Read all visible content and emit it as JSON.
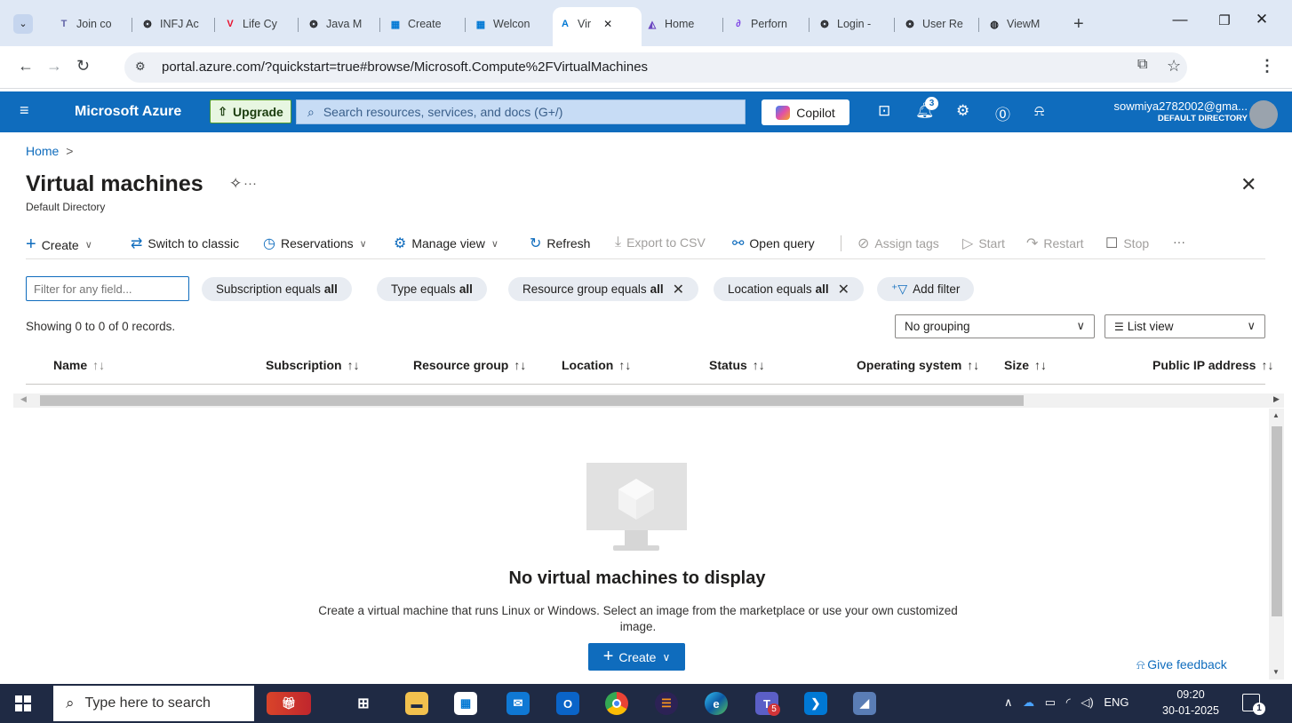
{
  "browser": {
    "tabs": [
      {
        "label": "Join co",
        "icon": "teams-icon",
        "color": "#6264a7"
      },
      {
        "label": "INFJ Ac",
        "icon": "chatgpt-icon",
        "color": "#202124"
      },
      {
        "label": "Life Cy",
        "icon": "v-logo-icon",
        "color": "#e8112d"
      },
      {
        "label": "Java M",
        "icon": "chatgpt-icon",
        "color": "#202124"
      },
      {
        "label": "Create",
        "icon": "ms-icon",
        "color": "#0078d4"
      },
      {
        "label": "Welcon",
        "icon": "ms-icon",
        "color": "#0078d4"
      },
      {
        "label": "Vir",
        "icon": "azure-icon",
        "color": "#0078d4",
        "active": true
      },
      {
        "label": "Home",
        "icon": "ai-icon",
        "color": "#6b46c1"
      },
      {
        "label": "Perforn",
        "icon": "flame-icon",
        "color": "#7b3fe4"
      },
      {
        "label": "Login -",
        "icon": "chatgpt-icon",
        "color": "#202124"
      },
      {
        "label": "User Re",
        "icon": "chatgpt-icon",
        "color": "#202124"
      },
      {
        "label": "ViewM",
        "icon": "globe-icon",
        "color": "#202124"
      }
    ],
    "url": "portal.azure.com/?quickstart=true#browse/Microsoft.Compute%2FVirtualMachines",
    "new_tab": "+"
  },
  "azure_header": {
    "brand": "Microsoft Azure",
    "upgrade": "Upgrade",
    "search_placeholder": "Search resources, services, and docs (G+/)",
    "copilot": "Copilot",
    "notifications_count": "3",
    "user_email": "sowmiya2782002@gma...",
    "user_directory": "DEFAULT DIRECTORY"
  },
  "page": {
    "breadcrumb_home": "Home",
    "breadcrumb_sep": ">",
    "title": "Virtual machines",
    "subtitle": "Default Directory"
  },
  "commands": {
    "create": "Create",
    "switch_classic": "Switch to classic",
    "reservations": "Reservations",
    "manage_view": "Manage view",
    "refresh": "Refresh",
    "export_csv": "Export to CSV",
    "open_query": "Open query",
    "assign_tags": "Assign tags",
    "start": "Start",
    "restart": "Restart",
    "stop": "Stop",
    "more": "···"
  },
  "filters": {
    "placeholder": "Filter for any field...",
    "subscription": {
      "label": "Subscription equals",
      "value": "all"
    },
    "type": {
      "label": "Type equals",
      "value": "all"
    },
    "resource_group": {
      "label": "Resource group equals",
      "value": "all"
    },
    "location": {
      "label": "Location equals",
      "value": "all"
    },
    "add_filter": "Add filter"
  },
  "records": "Showing 0 to 0 of 0 records.",
  "grouping": "No grouping",
  "view": "List view",
  "columns": {
    "name": "Name",
    "subscription": "Subscription",
    "resource_group": "Resource group",
    "location": "Location",
    "status": "Status",
    "os": "Operating system",
    "size": "Size",
    "public_ip": "Public IP address",
    "sort_glyph": "↑↓"
  },
  "empty": {
    "title": "No virtual machines to display",
    "description": "Create a virtual machine that runs Linux or Windows. Select an image from the marketplace or use your own customized image.",
    "create": "Create"
  },
  "feedback": "Give feedback",
  "taskbar": {
    "search_placeholder": "Type here to search",
    "language": "ENG",
    "time": "09:20",
    "date": "30-01-2025",
    "teams_badge": "5",
    "notif_badge": "1"
  },
  "colors": {
    "azure_blue": "#0f6cbd",
    "taskbar": "#1f2a44"
  }
}
